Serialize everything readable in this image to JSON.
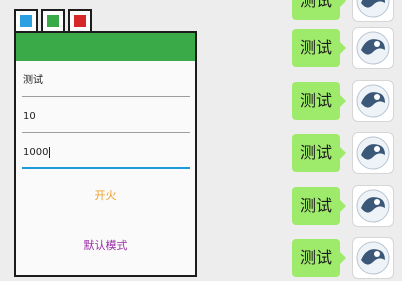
{
  "chat": {
    "messages": [
      {
        "text": "测试"
      },
      {
        "text": "测试"
      },
      {
        "text": "测试"
      },
      {
        "text": "测试"
      },
      {
        "text": "测试"
      },
      {
        "text": "测试"
      }
    ]
  },
  "popup": {
    "color_tabs": [
      {
        "color": "#2aa0e0"
      },
      {
        "color": "#3aaa48"
      },
      {
        "color": "#d62828"
      }
    ],
    "fields": [
      {
        "value": "测试"
      },
      {
        "value": "10"
      },
      {
        "value": "1000"
      }
    ],
    "buttons": {
      "fire_label": "开火",
      "fire_color": "#f0a028",
      "default_mode_label": "默认模式",
      "default_mode_color": "#9b2fa8"
    },
    "header_color": "#3aaa48",
    "focus_color": "#1f9ad8"
  }
}
